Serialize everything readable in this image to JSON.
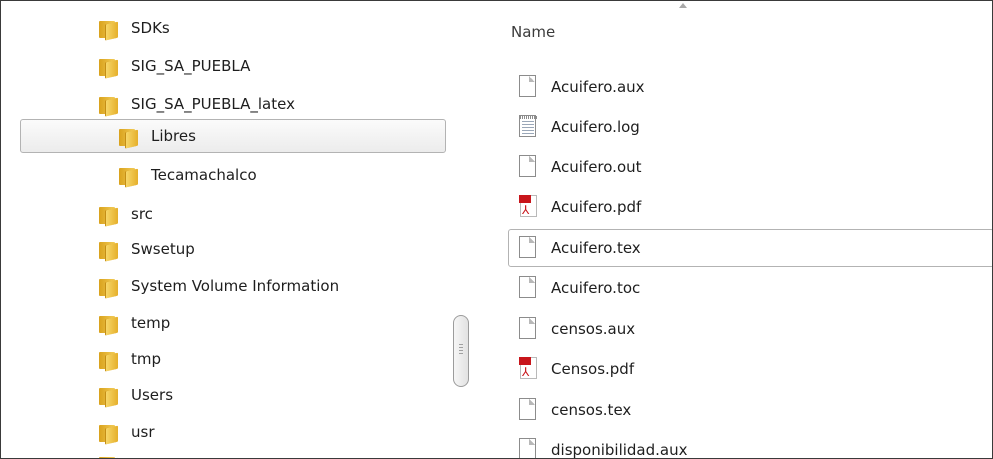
{
  "nav": {
    "items": [
      {
        "label": "SDKs"
      },
      {
        "label": "SIG_SA_PUEBLA"
      },
      {
        "label": "SIG_SA_PUEBLA_latex"
      },
      {
        "label": "Libres",
        "selected": true
      },
      {
        "label": "Tecamachalco"
      },
      {
        "label": "src"
      },
      {
        "label": "Swsetup"
      },
      {
        "label": "System Volume Information"
      },
      {
        "label": "temp"
      },
      {
        "label": "tmp"
      },
      {
        "label": "Users"
      },
      {
        "label": "usr"
      }
    ]
  },
  "files": {
    "column_header": "Name",
    "sort": "ascending",
    "rows": [
      {
        "name": "Acuifero.aux",
        "icon": "document-icon"
      },
      {
        "name": "Acuifero.log",
        "icon": "log-file-icon"
      },
      {
        "name": "Acuifero.out",
        "icon": "document-icon"
      },
      {
        "name": "Acuifero.pdf",
        "icon": "pdf-icon"
      },
      {
        "name": "Acuifero.tex",
        "icon": "document-icon",
        "selected": true
      },
      {
        "name": "Acuifero.toc",
        "icon": "document-icon"
      },
      {
        "name": "censos.aux",
        "icon": "document-icon"
      },
      {
        "name": "Censos.pdf",
        "icon": "pdf-icon"
      },
      {
        "name": "censos.tex",
        "icon": "document-icon"
      },
      {
        "name": "disponibilidad.aux",
        "icon": "document-icon"
      }
    ]
  },
  "colors": {
    "folder": "#f3cc58",
    "pdf_red": "#c8151b",
    "selection_border": "#b3b3b3"
  }
}
